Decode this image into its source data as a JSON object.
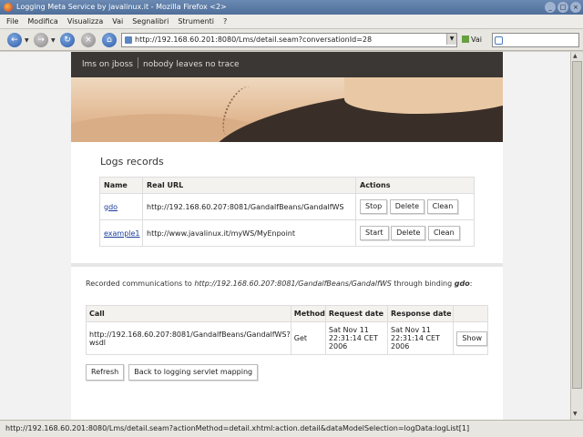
{
  "window": {
    "title": "Logging Meta Service by javalinux.it - Mozilla Firefox <2>",
    "buttons": [
      "_",
      "□",
      "×"
    ]
  },
  "menu": [
    "File",
    "Modifica",
    "Visualizza",
    "Vai",
    "Segnalibri",
    "Strumenti",
    "?"
  ],
  "nav": {
    "url": "http://192.168.60.201:8080/Lms/detail.seam?conversationId=28",
    "go_label": "Vai",
    "search_value": ""
  },
  "header": {
    "site_name": "lms on jboss",
    "tagline": "nobody leaves no trace"
  },
  "logs": {
    "title": "Logs records",
    "columns": [
      "Name",
      "Real URL",
      "Actions"
    ],
    "rows": [
      {
        "name": "gdo",
        "url": "http://192.168.60.207:8081/GandalfBeans/GandalfWS",
        "actions": [
          "Stop",
          "Delete",
          "Clean"
        ]
      },
      {
        "name": "example1",
        "url": "http://www.javalinux.it/myWS/MyEnpoint",
        "actions": [
          "Start",
          "Delete",
          "Clean"
        ]
      }
    ]
  },
  "recorded": {
    "prefix": "Recorded communications to ",
    "url": "http://192.168.60.207:8081/GandalfBeans/GandalfWS",
    "middle": " through binding ",
    "binding": "gdo",
    "suffix": ":"
  },
  "calls": {
    "columns": [
      "Call",
      "Method",
      "Request date",
      "Response date",
      ""
    ],
    "rows": [
      {
        "call": "http://192.168.60.207:8081/GandalfBeans/GandalfWS?wsdl",
        "method": "Get",
        "request": "Sat Nov 11 22:31:14 CET 2006",
        "response": "Sat Nov 11 22:31:14 CET 2006",
        "action": "Show"
      }
    ]
  },
  "bottom": {
    "refresh": "Refresh",
    "back": "Back to logging servlet mapping"
  },
  "status": "http://192.168.60.201:8080/Lms/detail.seam?actionMethod=detail.xhtml:action.detail&dataModelSelection=logData:logList[1]"
}
